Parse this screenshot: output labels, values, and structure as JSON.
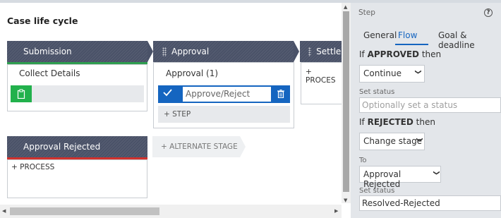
{
  "canvas": {
    "title": "Case life cycle",
    "stages": [
      {
        "label": "Submission",
        "underline_color": "#2e9e4f"
      },
      {
        "label": "Approval"
      },
      {
        "label": "Settlem"
      }
    ],
    "submission_step": "Collect Details",
    "approval_process": "Approval (1)",
    "approval_step_placeholder": "Approve/Reject",
    "add_step": "+ STEP",
    "add_process_settlement": "+ PROCES",
    "alt_stage": {
      "label": "Approval Rejected",
      "underline_color": "#d0312d"
    },
    "add_alternate_stage": "+ ALTERNATE STAGE",
    "add_process_alt": "+ PROCESS"
  },
  "panel": {
    "title": "Step",
    "help_icon": "?",
    "tabs": [
      "General",
      "Flow",
      "Goal & deadline"
    ],
    "active_tab": "Flow",
    "approved_prefix": "If ",
    "approved_keyword": "APPROVED",
    "approved_suffix": " then",
    "approved_action": "Continue",
    "set_status_label_1": "Set status",
    "set_status_placeholder": "Optionally set a status",
    "rejected_prefix": "If ",
    "rejected_keyword": "REJECTED",
    "rejected_suffix": " then",
    "rejected_action": "Change stage",
    "to_label": "To",
    "to_value": "Approval Rejected",
    "set_status_label_2": "Set status",
    "set_status_value": "Resolved-Rejected"
  },
  "colors": {
    "accent": "#1565c0",
    "stage": "#4a5268",
    "green": "#22b14c",
    "red": "#d0312d"
  }
}
